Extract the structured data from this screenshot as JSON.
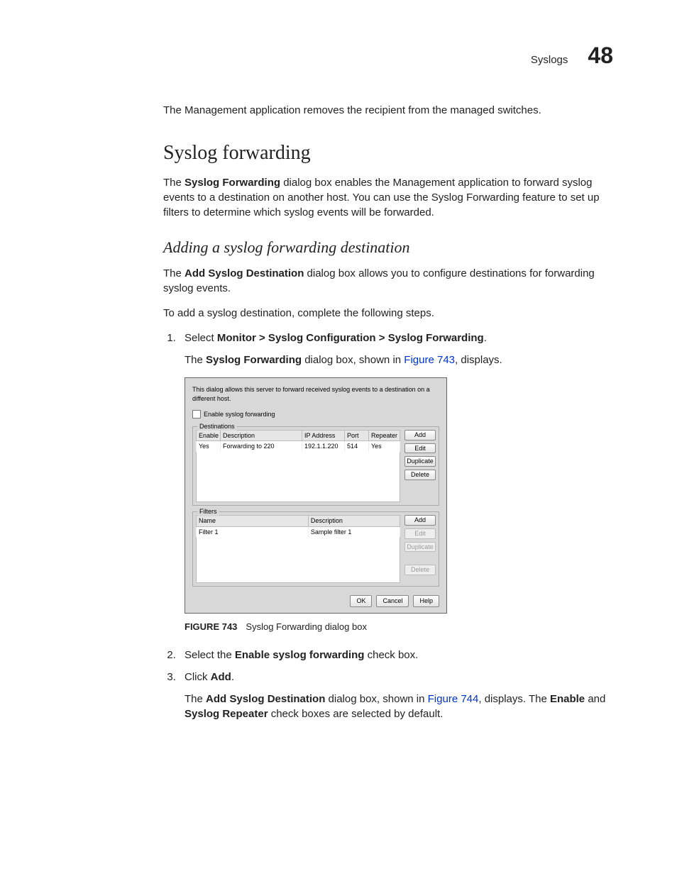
{
  "header": {
    "section": "Syslogs",
    "chapter": "48"
  },
  "intro": "The Management application removes the recipient from the managed switches.",
  "h2": "Syslog forwarding",
  "para1_pre": "The ",
  "para1_bold": "Syslog Forwarding",
  "para1_post": " dialog box enables the Management application to forward syslog events to a destination on another host. You can use the Syslog Forwarding feature to set up filters to determine which syslog events will be forwarded.",
  "h3": "Adding a syslog forwarding destination",
  "para2_pre": "The ",
  "para2_bold": "Add Syslog Destination",
  "para2_post": " dialog box allows you to configure destinations for forwarding syslog events.",
  "para3": "To add a syslog destination, complete the following steps.",
  "step1_pre": "Select ",
  "step1_bold": "Monitor > Syslog Configuration > Syslog Forwarding",
  "step1_post": ".",
  "step1_sub_pre": "The ",
  "step1_sub_bold": "Syslog Forwarding",
  "step1_sub_mid": " dialog box, shown in ",
  "step1_sub_link": "Figure 743",
  "step1_sub_post": ", displays.",
  "dialog": {
    "desc": "This dialog allows this server to forward received syslog events to a destination on a different host.",
    "enable": "Enable syslog forwarding",
    "dest_label": "Destinations",
    "dest_headers": [
      "Enable",
      "Description",
      "IP Address",
      "Port",
      "Repeater"
    ],
    "dest_row": [
      "Yes",
      "Forwarding to 220",
      "192.1.1.220",
      "514",
      "Yes"
    ],
    "buttons": {
      "add": "Add",
      "edit": "Edit",
      "duplicate": "Duplicate",
      "delete": "Delete"
    },
    "filter_label": "Filters",
    "filter_headers": [
      "Name",
      "Description"
    ],
    "filter_row": [
      "Filter 1",
      "Sample filter 1"
    ],
    "footer": {
      "ok": "OK",
      "cancel": "Cancel",
      "help": "Help"
    }
  },
  "figcap_label": "FIGURE 743",
  "figcap_text": "Syslog Forwarding dialog box",
  "step2_pre": "Select the ",
  "step2_bold": "Enable syslog forwarding",
  "step2_post": " check box.",
  "step3_pre": "Click ",
  "step3_bold": "Add",
  "step3_post": ".",
  "step3_sub_pre": "The ",
  "step3_sub_bold1": "Add Syslog Destination",
  "step3_sub_mid1": " dialog box, shown in ",
  "step3_sub_link": "Figure 744",
  "step3_sub_mid2": ", displays. The ",
  "step3_sub_bold2": "Enable",
  "step3_sub_mid3": " and ",
  "step3_sub_bold3": "Syslog Repeater",
  "step3_sub_post": " check boxes are selected by default."
}
